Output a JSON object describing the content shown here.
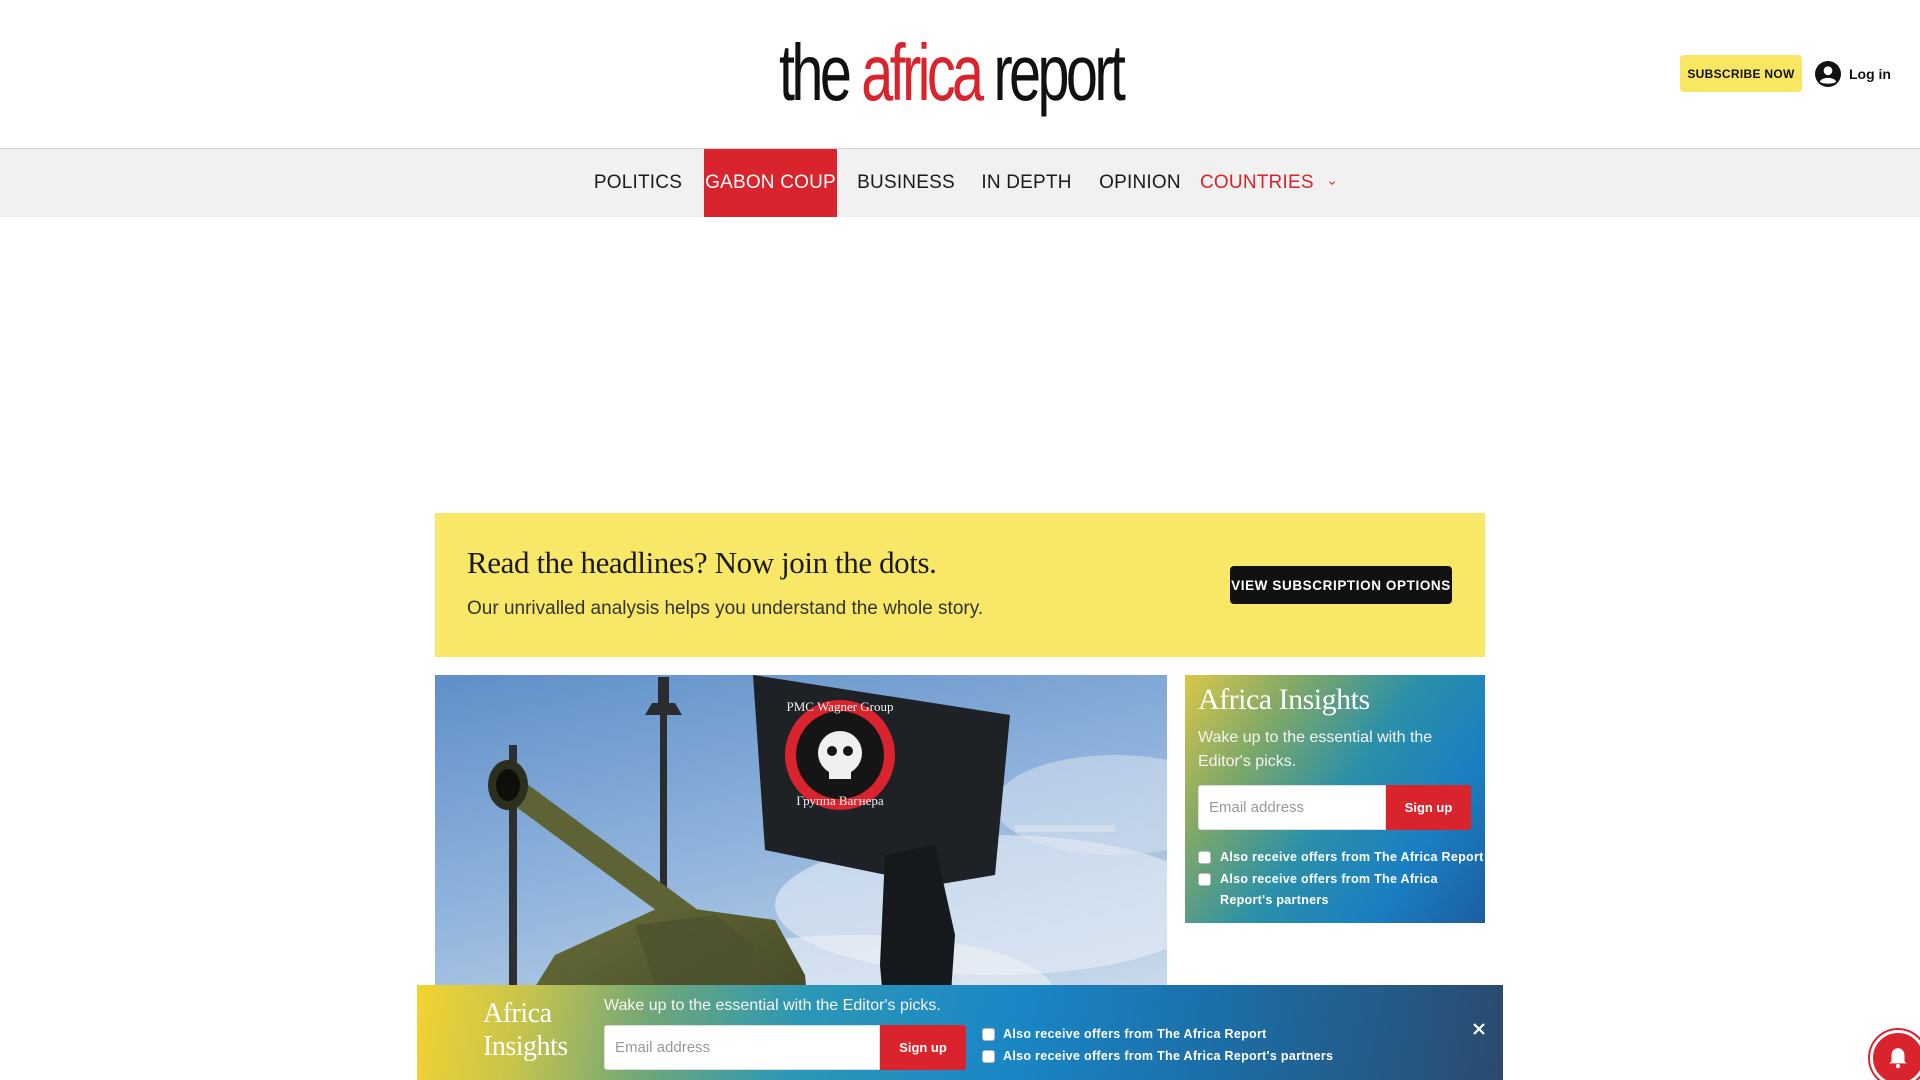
{
  "header": {
    "logo": {
      "part1": "the",
      "part2": "africa",
      "part3": "report"
    },
    "subscribe_label": "SUBSCRIBE NOW",
    "login_label": "Log in"
  },
  "nav": {
    "items": [
      {
        "label": "POLITICS"
      },
      {
        "label": "GABON COUP",
        "active": true
      },
      {
        "label": "BUSINESS"
      },
      {
        "label": "IN DEPTH"
      },
      {
        "label": "OPINION"
      },
      {
        "label": "COUNTRIES",
        "dropdown": true
      }
    ]
  },
  "promo": {
    "title": "Read the headlines? Now join the dots.",
    "subtitle": "Our unrivalled analysis helps you understand the whole story.",
    "button_label": "VIEW SUBSCRIPTION OPTIONS"
  },
  "hero": {
    "flag_text_top": "PMC Wagner Group",
    "flag_text_bottom": "Группа Вагнера"
  },
  "sidebar_newsletter": {
    "title": "Africa Insights",
    "subtitle": "Wake up to the essential with the Editor's picks.",
    "email_placeholder": "Email address",
    "signup_label": "Sign up",
    "checkbox1": "Also receive offers from The Africa Report",
    "checkbox2": "Also receive offers from The Africa Report's partners"
  },
  "bottom_bar": {
    "title": "Africa Insights",
    "subtitle": "Wake up to the essential with the Editor's picks.",
    "email_placeholder": "Email address",
    "signup_label": "Sign up",
    "checkbox1": "Also receive offers from The Africa Report",
    "checkbox2": "Also receive offers from The Africa Report's partners"
  },
  "colors": {
    "brand_red": "#d9232d",
    "promo_yellow": "#f9e868",
    "subscribe_yellow": "#f9e764"
  }
}
